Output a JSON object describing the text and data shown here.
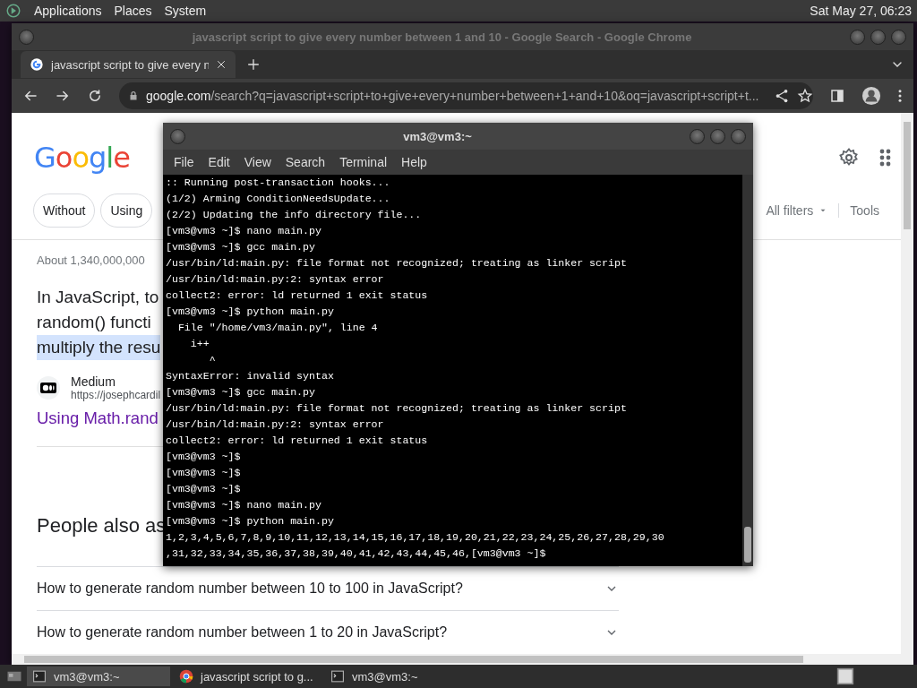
{
  "top_panel": {
    "menus": [
      "Applications",
      "Places",
      "System"
    ],
    "clock": "Sat May 27, 06:23"
  },
  "browser": {
    "title": "javascript script to give every number between 1 and 10 - Google Search - Google Chrome",
    "tabs": [
      {
        "label": "javascript script to give every n",
        "selected": true
      }
    ],
    "url": {
      "domain": "google.com",
      "path": "/search?q=javascript+script+to+give+every+number+between+1+and+10&oq=javascript+script+t..."
    },
    "page": {
      "logo": "Google",
      "chips": [
        "Without",
        "Using"
      ],
      "filters": [
        {
          "label": "All filters",
          "kind": "dropdown"
        },
        {
          "label": "Tools",
          "kind": "plain"
        }
      ],
      "result_count": "About 1,340,000,000",
      "snippet": [
        {
          "text": "In JavaScript, to",
          "highlighted": false
        },
        {
          "text": "random() functi",
          "highlighted": false
        },
        {
          "text": "multiply the resu",
          "highlighted": true
        }
      ],
      "source": {
        "name": "Medium",
        "url": "https://josephcardil"
      },
      "link": "Using Math.rand",
      "people_also_ask": {
        "heading": "People also as",
        "questions": [
          "How to generate random number between 10 to 100 in JavaScript?",
          "How to generate random number between 1 to 20 in JavaScript?"
        ]
      }
    }
  },
  "terminal": {
    "title": "vm3@vm3:~",
    "menu": [
      "File",
      "Edit",
      "View",
      "Search",
      "Terminal",
      "Help"
    ],
    "lines": [
      ":: Running post-transaction hooks...",
      "(1/2) Arming ConditionNeedsUpdate...",
      "(2/2) Updating the info directory file...",
      "[vm3@vm3 ~]$ nano main.py",
      "[vm3@vm3 ~]$ gcc main.py",
      "/usr/bin/ld:main.py: file format not recognized; treating as linker script",
      "/usr/bin/ld:main.py:2: syntax error",
      "collect2: error: ld returned 1 exit status",
      "[vm3@vm3 ~]$ python main.py",
      "  File \"/home/vm3/main.py\", line 4",
      "    i++",
      "       ^",
      "SyntaxError: invalid syntax",
      "[vm3@vm3 ~]$ gcc main.py",
      "/usr/bin/ld:main.py: file format not recognized; treating as linker script",
      "/usr/bin/ld:main.py:2: syntax error",
      "collect2: error: ld returned 1 exit status",
      "[vm3@vm3 ~]$",
      "[vm3@vm3 ~]$",
      "[vm3@vm3 ~]$",
      "[vm3@vm3 ~]$ nano main.py",
      "[vm3@vm3 ~]$ python main.py",
      "1,2,3,4,5,6,7,8,9,10,11,12,13,14,15,16,17,18,19,20,21,22,23,24,25,26,27,28,29,30",
      ",31,32,33,34,35,36,37,38,39,40,41,42,43,44,45,46,[vm3@vm3 ~]$"
    ]
  },
  "taskbar": {
    "items": [
      {
        "label": "vm3@vm3:~",
        "kind": "terminal",
        "selected": true
      },
      {
        "label": "javascript script to g...",
        "kind": "browser",
        "selected": false
      },
      {
        "label": "vm3@vm3:~",
        "kind": "terminal",
        "selected": false
      }
    ]
  }
}
